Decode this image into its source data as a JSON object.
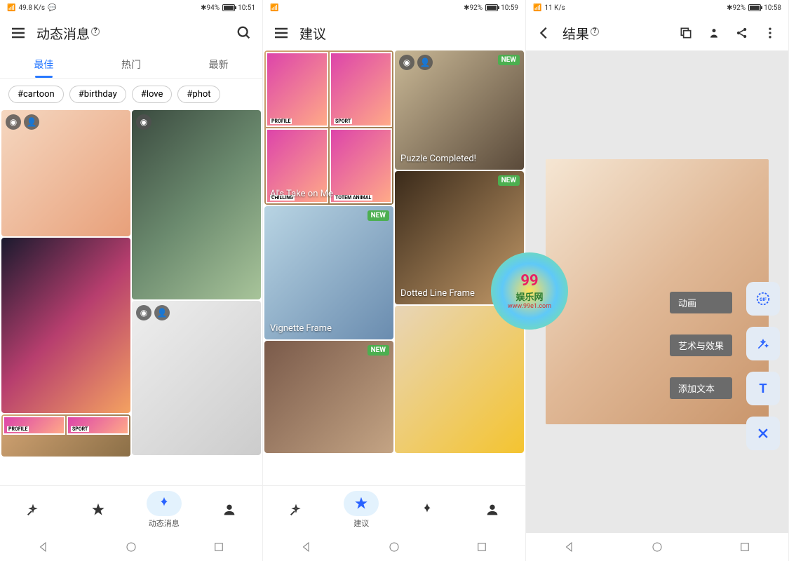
{
  "screen1": {
    "status": {
      "speed": "49.8 K/s",
      "battery": "94%",
      "bt": "✱94%",
      "time": "10:51"
    },
    "header": {
      "title": "动态消息"
    },
    "tabs": [
      "最佳",
      "热门",
      "最新"
    ],
    "active_tab": 0,
    "chips": [
      "#cartoon",
      "#birthday",
      "#love",
      "#phot"
    ],
    "nav": {
      "items": [
        "",
        "",
        "动态消息",
        ""
      ],
      "active": 2
    }
  },
  "screen2": {
    "status": {
      "bt": "✱92%",
      "time": "10:59"
    },
    "header": {
      "title": "建议"
    },
    "cards": {
      "ai_take": "Al's Take on Me",
      "comic_labels": [
        "PROFILE",
        "SPORT",
        "CHILLING",
        "TOTEM ANIMAL"
      ],
      "vignette": "Vignette Frame",
      "puzzle": "Puzzle Completed!",
      "dotted": "Dotted Line Frame",
      "new_badge": "NEW"
    },
    "nav": {
      "items": [
        "",
        "建议",
        "",
        ""
      ],
      "active": 1
    }
  },
  "screen3": {
    "status": {
      "speed": "11 K/s",
      "bt": "✱92%",
      "time": "10:58"
    },
    "header": {
      "title": "结果"
    },
    "labels": {
      "anim": "动画",
      "art": "艺术与效果",
      "text": "添加文本"
    },
    "watermark": {
      "num": "99",
      "text": "娱乐网",
      "url": "www.99e1.com"
    }
  }
}
